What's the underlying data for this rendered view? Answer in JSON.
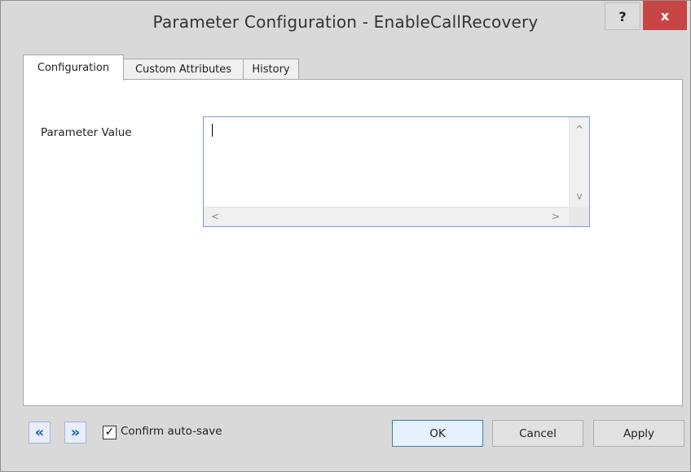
{
  "window": {
    "title": "Parameter Configuration - EnableCallRecovery",
    "help_label": "?",
    "close_label": "x"
  },
  "tabs": [
    {
      "label": "Configuration",
      "active": true
    },
    {
      "label": "Custom Attributes",
      "active": false
    },
    {
      "label": "History",
      "active": false
    }
  ],
  "form": {
    "parameter_label": "Parameter Value",
    "parameter_value": ""
  },
  "icons": {
    "scroll_up": "^",
    "scroll_down": "v",
    "scroll_left": "<",
    "scroll_right": ">",
    "prev": "«",
    "next": "»",
    "check": "✓"
  },
  "footer": {
    "confirm_autosave_label": "Confirm auto-save",
    "confirm_autosave_checked": true,
    "ok_label": "OK",
    "cancel_label": "Cancel",
    "apply_label": "Apply"
  },
  "colors": {
    "close_button": "#c84545",
    "nav_arrow": "#1a5fcf",
    "focus_border": "#7a9cc8"
  }
}
